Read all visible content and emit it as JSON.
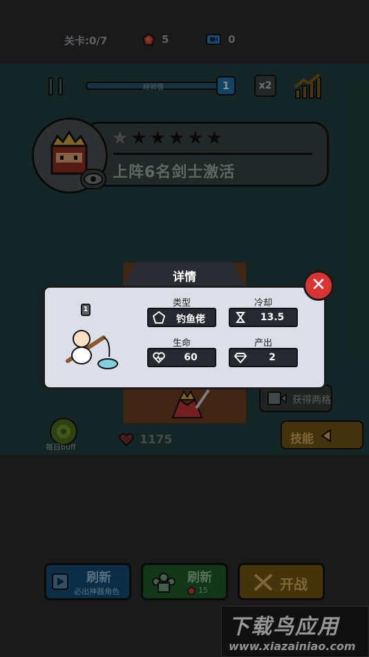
{
  "hud": {
    "level_progress": "关卡:0/7",
    "gems": "5",
    "tickets": "0",
    "xp_label": "经验值",
    "player_level": "1",
    "speed": "x2"
  },
  "mission": {
    "stars_filled": 1,
    "stars_total": 6,
    "text": "上阵6名剑士激活"
  },
  "field": {
    "get_two_slots": "获得两格",
    "skill_label": "技能",
    "daily_buff": "每日buff",
    "hp": "1175"
  },
  "bottom": {
    "refresh_ad_title": "刷新",
    "refresh_ad_sub": "必出神器角色",
    "refresh_gem_title": "刷新",
    "refresh_gem_cost": "15",
    "fight": "开战"
  },
  "dialog": {
    "title": "详情",
    "unit_level": "1",
    "stats": {
      "type_label": "类型",
      "type_value": "钓鱼佬",
      "cooldown_label": "冷却",
      "cooldown_value": "13.5",
      "hp_label": "生命",
      "hp_value": "60",
      "output_label": "产出",
      "output_value": "2"
    }
  },
  "watermark": {
    "title": "下载鸟应用",
    "url": "www.xiazainiao.com"
  },
  "colors": {
    "close_red": "#d93434",
    "dialog_bg": "#dcdee8",
    "stat_box": "#272930",
    "fish_cyan": "#7fd3e0"
  }
}
